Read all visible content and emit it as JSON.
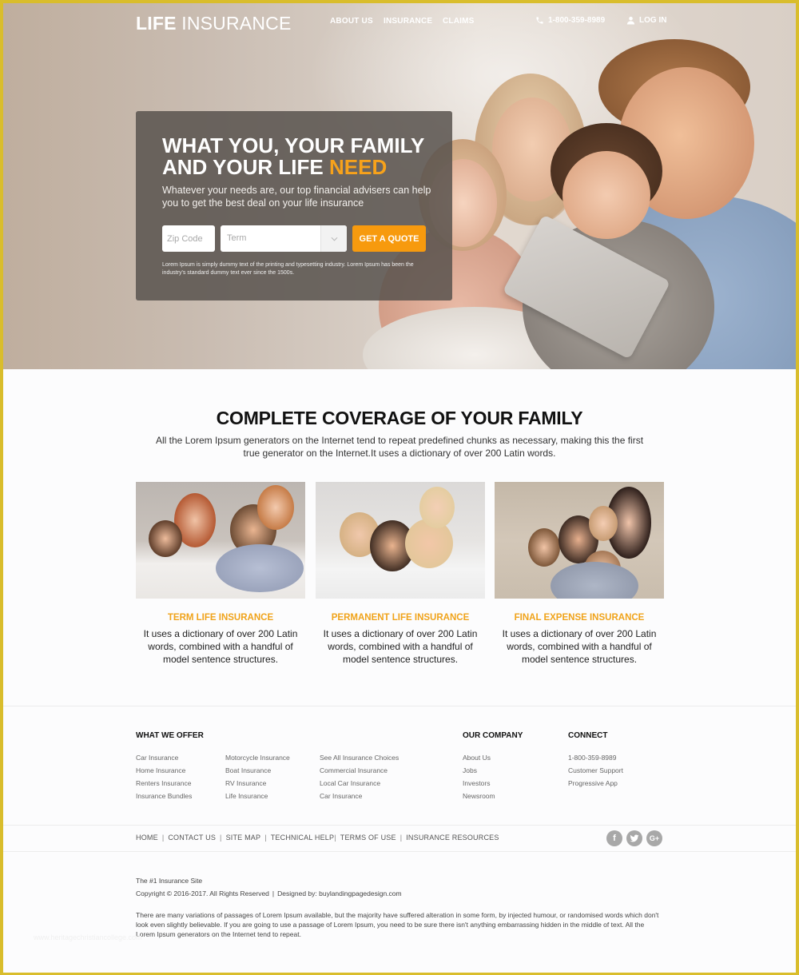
{
  "nav": {
    "logo_bold": "LIFE",
    "logo_regular": "INSURANCE",
    "links": [
      "ABOUT US",
      "INSURANCE",
      "CLAIMS"
    ],
    "phone": "1-800-359-8989",
    "phone_icon": "phone-icon",
    "login": "LOG IN",
    "login_icon": "user-icon"
  },
  "hero": {
    "headline_line1": "WHAT YOU, YOUR FAMILY",
    "headline_line2": "AND YOUR LIFE",
    "headline_accent": "NEED",
    "subheadline": "Whatever your needs are, our top financial advisers can help you to get the best deal on your life insurance",
    "zip_placeholder": "Zip Code",
    "term_select_value": "Term",
    "quote_button": "GET A QUOTE",
    "disclaimer": "Lorem Ipsum is simply dummy text of the printing and typesetting industry. Lorem Ipsum has been the industry's standard dummy text ever since the 1500s."
  },
  "coverage": {
    "title": "COMPLETE COVERAGE OF YOUR FAMILY",
    "description": "All the Lorem Ipsum generators on the Internet tend to repeat predefined chunks as necessary, making this the first true generator on the Internet.It uses a dictionary of over 200 Latin words.",
    "cards": [
      {
        "title": "TERM LIFE INSURANCE",
        "text": "It uses a dictionary of over 200 Latin words, combined with a handful of model sentence structures."
      },
      {
        "title": "PERMANENT LIFE INSURANCE",
        "text": "It uses a dictionary of over 200 Latin words, combined with a handful of model sentence structures."
      },
      {
        "title": "FINAL EXPENSE INSURANCE",
        "text": "It uses a dictionary of over 200 Latin words, combined with a handful of model sentence structures."
      }
    ]
  },
  "footer": {
    "what_we_offer": {
      "heading": "WHAT WE OFFER",
      "col1": [
        "Car Insurance",
        "Home Insurance",
        "Renters Insurance",
        "Insurance Bundles"
      ],
      "col2": [
        "Motorcycle Insurance",
        "Boat Insurance",
        "RV Insurance",
        "Life Insurance"
      ],
      "col3": [
        "See All Insurance Choices",
        "Commercial Insurance",
        "Local Car Insurance",
        "Car Insurance"
      ]
    },
    "our_company": {
      "heading": "OUR COMPANY",
      "links": [
        "About Us",
        "Jobs",
        "Investors",
        "Newsroom"
      ]
    },
    "connect": {
      "heading": "CONNECT",
      "links": [
        "1-800-359-8989",
        "Customer Support",
        "Progressive App"
      ]
    },
    "bottom_links": [
      "HOME",
      "CONTACT US",
      "SITE MAP",
      "TECHNICAL HELP",
      "TERMS OF USE",
      "INSURANCE RESOURCES"
    ],
    "social": [
      {
        "icon": "facebook-icon",
        "glyph": "f"
      },
      {
        "icon": "twitter-icon",
        "glyph": "t"
      },
      {
        "icon": "google-plus-icon",
        "glyph": "G+"
      }
    ],
    "tagline": "The #1 Insurance Site",
    "copyright": "Copyright © 2016-2017. All Rights Reserved",
    "designed_by": "Designed by: buylandingpagedesign.com",
    "lorem": "There are many variations of passages of Lorem Ipsum available, but the majority have suffered alteration in some form, by injected humour, or randomised words which don't look even slightly believable. If you are going to use a passage of Lorem Ipsum, you need to be sure there isn't anything embarrassing hidden in the middle of text. All the Lorem Ipsum generators on the Internet tend to repeat.",
    "watermark": "www.heritagechristiancollege.com"
  },
  "colors": {
    "accent": "#f79a0e",
    "frame_border": "#d9bd2c",
    "panel_bg": "#58524e"
  }
}
